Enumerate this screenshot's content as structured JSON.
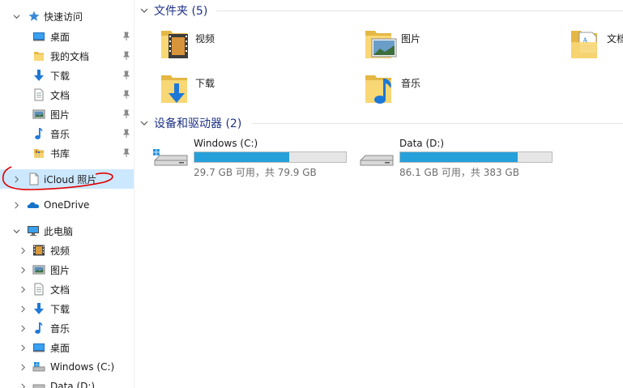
{
  "sidebar": {
    "quick_access": {
      "label": "快速访问",
      "items": [
        {
          "label": "桌面",
          "icon": "desktop-icon",
          "pinned": true
        },
        {
          "label": "我的文档",
          "icon": "folder-icon",
          "pinned": true
        },
        {
          "label": "下载",
          "icon": "download-arrow-icon",
          "pinned": true
        },
        {
          "label": "文档",
          "icon": "document-icon",
          "pinned": true
        },
        {
          "label": "图片",
          "icon": "pictures-icon",
          "pinned": true
        },
        {
          "label": "音乐",
          "icon": "music-note-icon",
          "pinned": true
        },
        {
          "label": "书库",
          "icon": "library-icon",
          "pinned": true
        }
      ]
    },
    "icloud": {
      "label": "iCloud 照片",
      "icon": "document-icon",
      "selected": true
    },
    "onedrive": {
      "label": "OneDrive",
      "icon": "cloud-icon"
    },
    "this_pc": {
      "label": "此电脑",
      "items": [
        {
          "label": "视频",
          "icon": "video-icon"
        },
        {
          "label": "图片",
          "icon": "pictures-icon"
        },
        {
          "label": "文档",
          "icon": "document-icon"
        },
        {
          "label": "下载",
          "icon": "download-arrow-icon"
        },
        {
          "label": "音乐",
          "icon": "music-note-icon"
        },
        {
          "label": "桌面",
          "icon": "desktop-icon"
        },
        {
          "label": "Windows (C:)",
          "icon": "windows-drive-icon"
        },
        {
          "label": "Data (D:)",
          "icon": "drive-icon"
        }
      ]
    }
  },
  "main": {
    "folders": {
      "title": "文件夹 (5)",
      "items": [
        {
          "label": "视频",
          "icon": "video-folder-icon"
        },
        {
          "label": "图片",
          "icon": "pictures-folder-icon"
        },
        {
          "label": "文档",
          "icon": "documents-folder-icon"
        },
        {
          "label": "下载",
          "icon": "downloads-folder-icon"
        },
        {
          "label": "音乐",
          "icon": "music-folder-icon"
        }
      ]
    },
    "drives": {
      "title": "设备和驱动器 (2)",
      "items": [
        {
          "name": "Windows (C:)",
          "free_text": "29.7 GB 可用，共 79.9 GB",
          "used_fraction": 0.628,
          "icon": "windows-drive-icon"
        },
        {
          "name": "Data (D:)",
          "free_text": "86.1 GB 可用，共 383 GB",
          "used_fraction": 0.775,
          "icon": "drive-icon"
        }
      ]
    }
  },
  "colors": {
    "accent": "#26a0da",
    "selection": "#cce8ff",
    "group_title": "#1e3287",
    "annotation": "#e00000"
  }
}
